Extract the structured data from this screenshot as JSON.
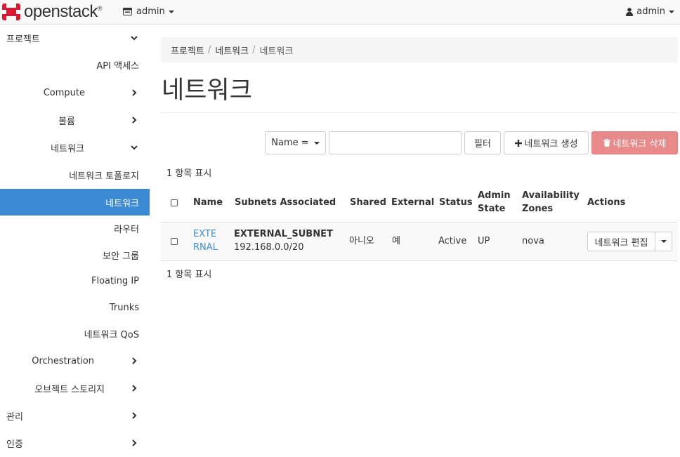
{
  "navbar": {
    "logo_text": "openstack",
    "logo_mark": "®",
    "project_label": "admin",
    "project_icon": "project-icon",
    "user_label": "admin",
    "user_icon": "user-icon"
  },
  "sidebar": {
    "items": [
      {
        "label": "프로젝트"
      },
      {
        "label": "API 액세스"
      },
      {
        "label": "Compute"
      },
      {
        "label": "볼륨"
      },
      {
        "label": "네트워크"
      },
      {
        "label": "네트워크 토폴로지"
      },
      {
        "label": "네트워크"
      },
      {
        "label": "라우터"
      },
      {
        "label": "보안 그룹"
      },
      {
        "label": "Floating IP"
      },
      {
        "label": "Trunks"
      },
      {
        "label": "네트워크 QoS"
      },
      {
        "label": "Orchestration"
      },
      {
        "label": "오브젝트 스토리지"
      },
      {
        "label": "관리"
      },
      {
        "label": "인증"
      }
    ],
    "active_color": "#3b8ad3"
  },
  "breadcrumb": [
    "프로젝트",
    "네트워크",
    "네트워크"
  ],
  "breadcrumb_sep": "/",
  "page_title": "네트워크",
  "toolbar": {
    "filter_field": "Name =",
    "filter_placeholder": "",
    "filter_button": "필터",
    "create_button": "네트워크 생성",
    "delete_button": "네트워크 삭제"
  },
  "count_label": "1 항목 표시",
  "table": {
    "headers": {
      "name": "Name",
      "subnets": "Subnets Associated",
      "shared": "Shared",
      "external": "External",
      "status": "Status",
      "admin_state_1": "Admin",
      "admin_state_2": "State",
      "az_1": "Availability",
      "az_2": "Zones",
      "actions": "Actions"
    },
    "rows": [
      {
        "name_1": "EXTE",
        "name_2": "RNAL",
        "subnet_name": "EXTERNAL_SUBNET",
        "subnet_cidr": "192.168.0.0/20",
        "shared": "아니오",
        "external": "예",
        "status": "Active",
        "admin_state": "UP",
        "zones": "nova",
        "action": "네트워크 편집"
      }
    ]
  }
}
